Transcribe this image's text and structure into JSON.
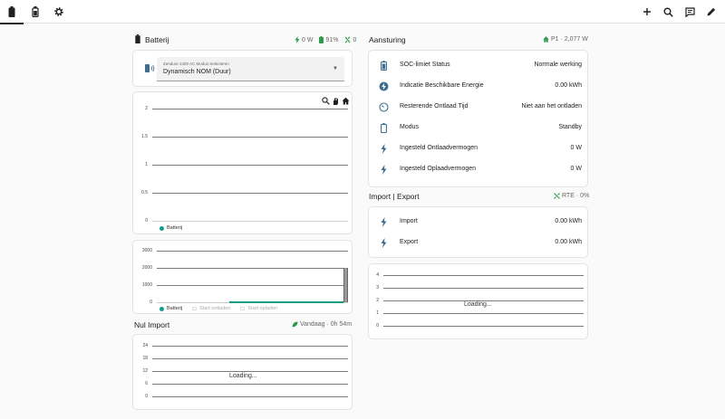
{
  "colors": {
    "accent": "#0f9d8a",
    "icon_blue": "#3f6e8f",
    "green": "#2e9a4e",
    "dark": "#212121"
  },
  "tabs": [
    {
      "icon": "battery-icon"
    },
    {
      "icon": "battery-outline-icon"
    },
    {
      "icon": "gear-icon"
    }
  ],
  "actions": [
    "plus-icon",
    "search-icon",
    "message-icon",
    "pencil-icon"
  ],
  "battery": {
    "title": "Batterij",
    "meta_power": "0 W",
    "meta_soc": "91%",
    "meta_flow": "0",
    "select": {
      "label": "Zendure 2400 AC Modus Selecteren",
      "value": "Dynamisch NOM (Duur)"
    },
    "chart1": {
      "type": "line",
      "yticks": [
        "2",
        "1.5",
        "1",
        "0.5",
        "0"
      ],
      "ylim": [
        0,
        2
      ],
      "legend": "Batterij"
    },
    "chart2": {
      "type": "area",
      "yticks": [
        "3000",
        "2000",
        "1000",
        "0"
      ],
      "ylim": [
        0,
        3000
      ],
      "legend": [
        "Batterij",
        "Start ontladen",
        "Start opladen"
      ]
    }
  },
  "nul_import": {
    "title": "Nul Import",
    "meta": "Vandaag · 0h 54m",
    "yticks": [
      "24",
      "18",
      "12",
      "6",
      "0"
    ],
    "loading": "Loading..."
  },
  "aansturing": {
    "title": "Aansturing",
    "meta": "P1 · 2,077 W",
    "rows": [
      {
        "icon": "battery-status-icon",
        "label": "SOC-limiet Status",
        "value": "Normale werking"
      },
      {
        "icon": "energy-icon",
        "label": "Indicatie Beschikbare Energie",
        "value": "0.00 kWh"
      },
      {
        "icon": "timer-icon",
        "label": "Resterende Ontlaad Tijd",
        "value": "Niet aan het ontladen"
      },
      {
        "icon": "battery-icon",
        "label": "Modus",
        "value": "Standby"
      },
      {
        "icon": "flash-icon",
        "label": "Ingesteld Ontlaadvermogen",
        "value": "0 W"
      },
      {
        "icon": "flash-icon",
        "label": "Ingesteld Oplaadvermogen",
        "value": "0 W"
      }
    ]
  },
  "import_export": {
    "title": "Import | Export",
    "meta": "RTE · 0%",
    "rows": [
      {
        "icon": "flash-icon",
        "label": "Import",
        "value": "0.00 kWh"
      },
      {
        "icon": "flash-icon",
        "label": "Export",
        "value": "0.00 kWh"
      }
    ],
    "yticks": [
      "4",
      "3",
      "2",
      "1",
      "0"
    ],
    "loading": "Loading..."
  }
}
